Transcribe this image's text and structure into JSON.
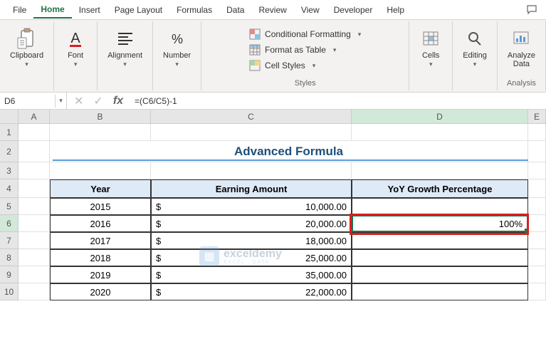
{
  "menu": {
    "tabs": [
      "File",
      "Home",
      "Insert",
      "Page Layout",
      "Formulas",
      "Data",
      "Review",
      "View",
      "Developer",
      "Help"
    ],
    "active_index": 1
  },
  "ribbon": {
    "clipboard": "Clipboard",
    "font": "Font",
    "alignment": "Alignment",
    "number": "Number",
    "styles": "Styles",
    "cond_fmt": "Conditional Formatting",
    "fmt_table": "Format as Table",
    "cell_styles": "Cell Styles",
    "cells": "Cells",
    "editing": "Editing",
    "analyze": "Analyze Data",
    "analysis": "Analysis"
  },
  "namebox": "D6",
  "formula": "=(C6/C5)-1",
  "columns": [
    "A",
    "B",
    "C",
    "D",
    "E"
  ],
  "title": "Advanced Formula",
  "headers": {
    "year": "Year",
    "earning": "Earning Amount",
    "yoy": "YoY Growth Percentage"
  },
  "rows": [
    {
      "year": "2015",
      "amount": "10,000.00",
      "yoy": ""
    },
    {
      "year": "2016",
      "amount": "20,000.00",
      "yoy": "100%"
    },
    {
      "year": "2017",
      "amount": "18,000.00",
      "yoy": ""
    },
    {
      "year": "2018",
      "amount": "25,000.00",
      "yoy": ""
    },
    {
      "year": "2019",
      "amount": "35,000.00",
      "yoy": ""
    },
    {
      "year": "2020",
      "amount": "22,000.00",
      "yoy": ""
    }
  ],
  "currency": "$",
  "watermark": {
    "main": "exceldemy",
    "sub": "EXCEL · DATA"
  }
}
